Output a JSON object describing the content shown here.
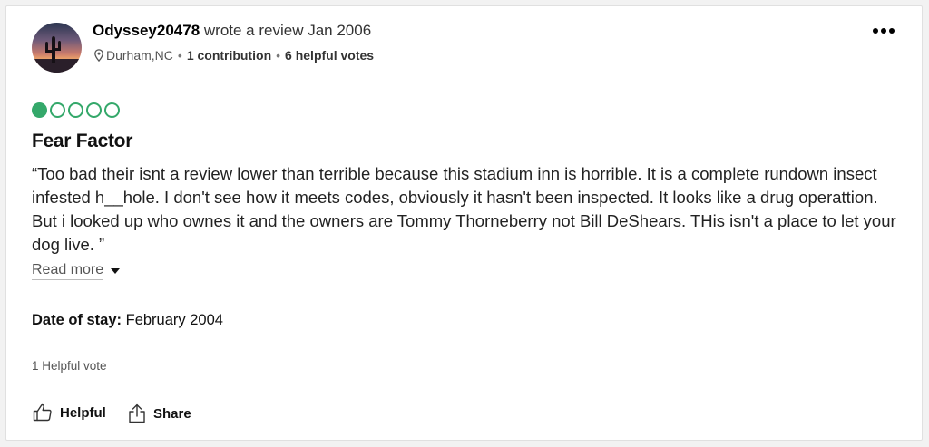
{
  "review": {
    "author": "Odyssey20478",
    "wrote_text": "wrote a review Jan 2006",
    "location": "Durham,NC",
    "contributions": "1 contribution",
    "helpful_votes": "6 helpful votes",
    "rating": {
      "value": 1,
      "max": 5,
      "color": "#34a86a"
    },
    "title": "Fear Factor",
    "body": "“Too bad their isnt a review lower than terrible because this stadium inn is horrible. It is a complete rundown insect infested h__hole. I don't see how it meets codes, obviously it hasn't been inspected. It looks like a drug operattion. But i looked up who ownes it and the owners are Tommy Thorneberry not Bill DeShears. THis isn't a place to let your dog live. ”",
    "read_more_label": "Read more",
    "date_of_stay_label": "Date of stay:",
    "date_of_stay_value": "February 2004",
    "helpful_count_text": "1 Helpful vote",
    "actions": {
      "helpful_label": "Helpful",
      "share_label": "Share"
    }
  },
  "icons": {
    "location": "map-pin-icon",
    "more": "more-options-icon",
    "helpful": "thumbs-up-icon",
    "share": "share-icon"
  }
}
